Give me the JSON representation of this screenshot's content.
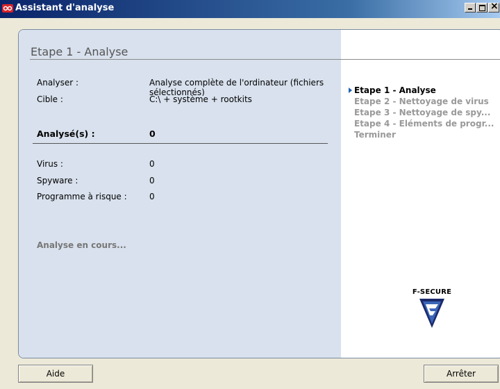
{
  "window": {
    "title": "Assistant d'analyse",
    "icon": "fsecure-app-icon",
    "controls": [
      "minimize",
      "maximize",
      "close"
    ]
  },
  "main": {
    "step_title": "Etape 1 - Analyse",
    "analyse_label": "Analyser :",
    "analyse_value": "Analyse complète de l'ordinateur (fichiers sélectionnés)",
    "target_label": "Cible :",
    "target_value": "C:\\  + système + rootkits",
    "analysed_label": "Analysé(s) :",
    "analysed_value": "0",
    "virus_label": "Virus :",
    "virus_value": "0",
    "spyware_label": "Spyware :",
    "spyware_value": "0",
    "risk_label": "Programme à risque :",
    "risk_value": "0",
    "status": "Analyse en cours..."
  },
  "steps": [
    {
      "label": "Etape 1 - Analyse",
      "active": true
    },
    {
      "label": "Etape 2 - Nettoyage de virus",
      "active": false
    },
    {
      "label": "Etape 3 - Nettoyage de spy...",
      "active": false
    },
    {
      "label": "Etape 4 - Eléments de progr...",
      "active": false
    },
    {
      "label": "Terminer",
      "active": false
    }
  ],
  "logo": {
    "text": "F-SECURE",
    "icon": "fsecure-shield-logo"
  },
  "buttons": {
    "help": "Aide",
    "stop": "Arrêter"
  },
  "colors": {
    "titlebar_start": "#0a246a",
    "left_panel": "#d8e1ed",
    "accent": "#1f5fb0"
  }
}
